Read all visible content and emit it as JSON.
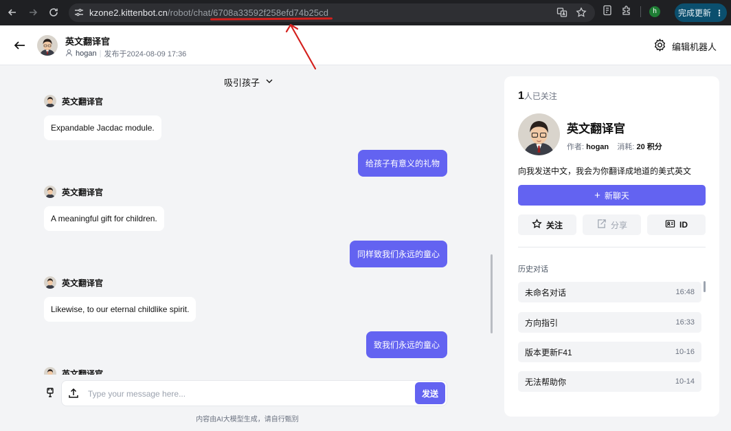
{
  "browser": {
    "url_domain": "kzone2.kittenbot.cn",
    "url_path": "/robot/chat/6708a33592f258efd74b25cd",
    "profile_initial": "h",
    "update_label": "完成更新"
  },
  "header": {
    "bot_name": "英文翻译官",
    "author": "hogan",
    "published": "发布于2024-08-09 17:36",
    "edit_label": "编辑机器人"
  },
  "chat": {
    "topic": "吸引孩子",
    "messages": [
      {
        "role": "bot",
        "name": "英文翻译官",
        "text": "Expandable Jacdac module."
      },
      {
        "role": "user",
        "text": "给孩子有意义的礼物"
      },
      {
        "role": "bot",
        "name": "英文翻译官",
        "text": "A meaningful gift for children."
      },
      {
        "role": "user",
        "text": "同样致我们永远的童心"
      },
      {
        "role": "bot",
        "name": "英文翻译官",
        "text": "Likewise, to our eternal childlike spirit."
      },
      {
        "role": "user",
        "text": "致我们永远的童心"
      },
      {
        "role": "bot",
        "name": "英文翻译官",
        "text": ""
      }
    ],
    "input_placeholder": "Type your message here...",
    "send_label": "发送",
    "disclaimer": "内容由AI大模型生成，请自行甄别"
  },
  "panel": {
    "followers_count": "1",
    "followers_label": "人已关注",
    "bot_name": "英文翻译官",
    "author_label": "作者:",
    "author": "hogan",
    "cost_label": "消耗:",
    "cost": "20 积分",
    "description": "向我发送中文，我会为你翻译成地道的美式英文",
    "new_chat_label": "新聊天",
    "follow_label": "关注",
    "share_label": "分享",
    "id_label": "ID",
    "history_title": "历史对话",
    "history": [
      {
        "title": "未命名对话",
        "time": "16:48"
      },
      {
        "title": "方向指引",
        "time": "16:33"
      },
      {
        "title": "版本更新F41",
        "time": "10-16"
      },
      {
        "title": "无法帮助你",
        "time": "10-14"
      }
    ]
  },
  "colors": {
    "accent": "#6363f1",
    "chrome_bg": "#1f2023",
    "annotation_red": "#d4201d"
  }
}
